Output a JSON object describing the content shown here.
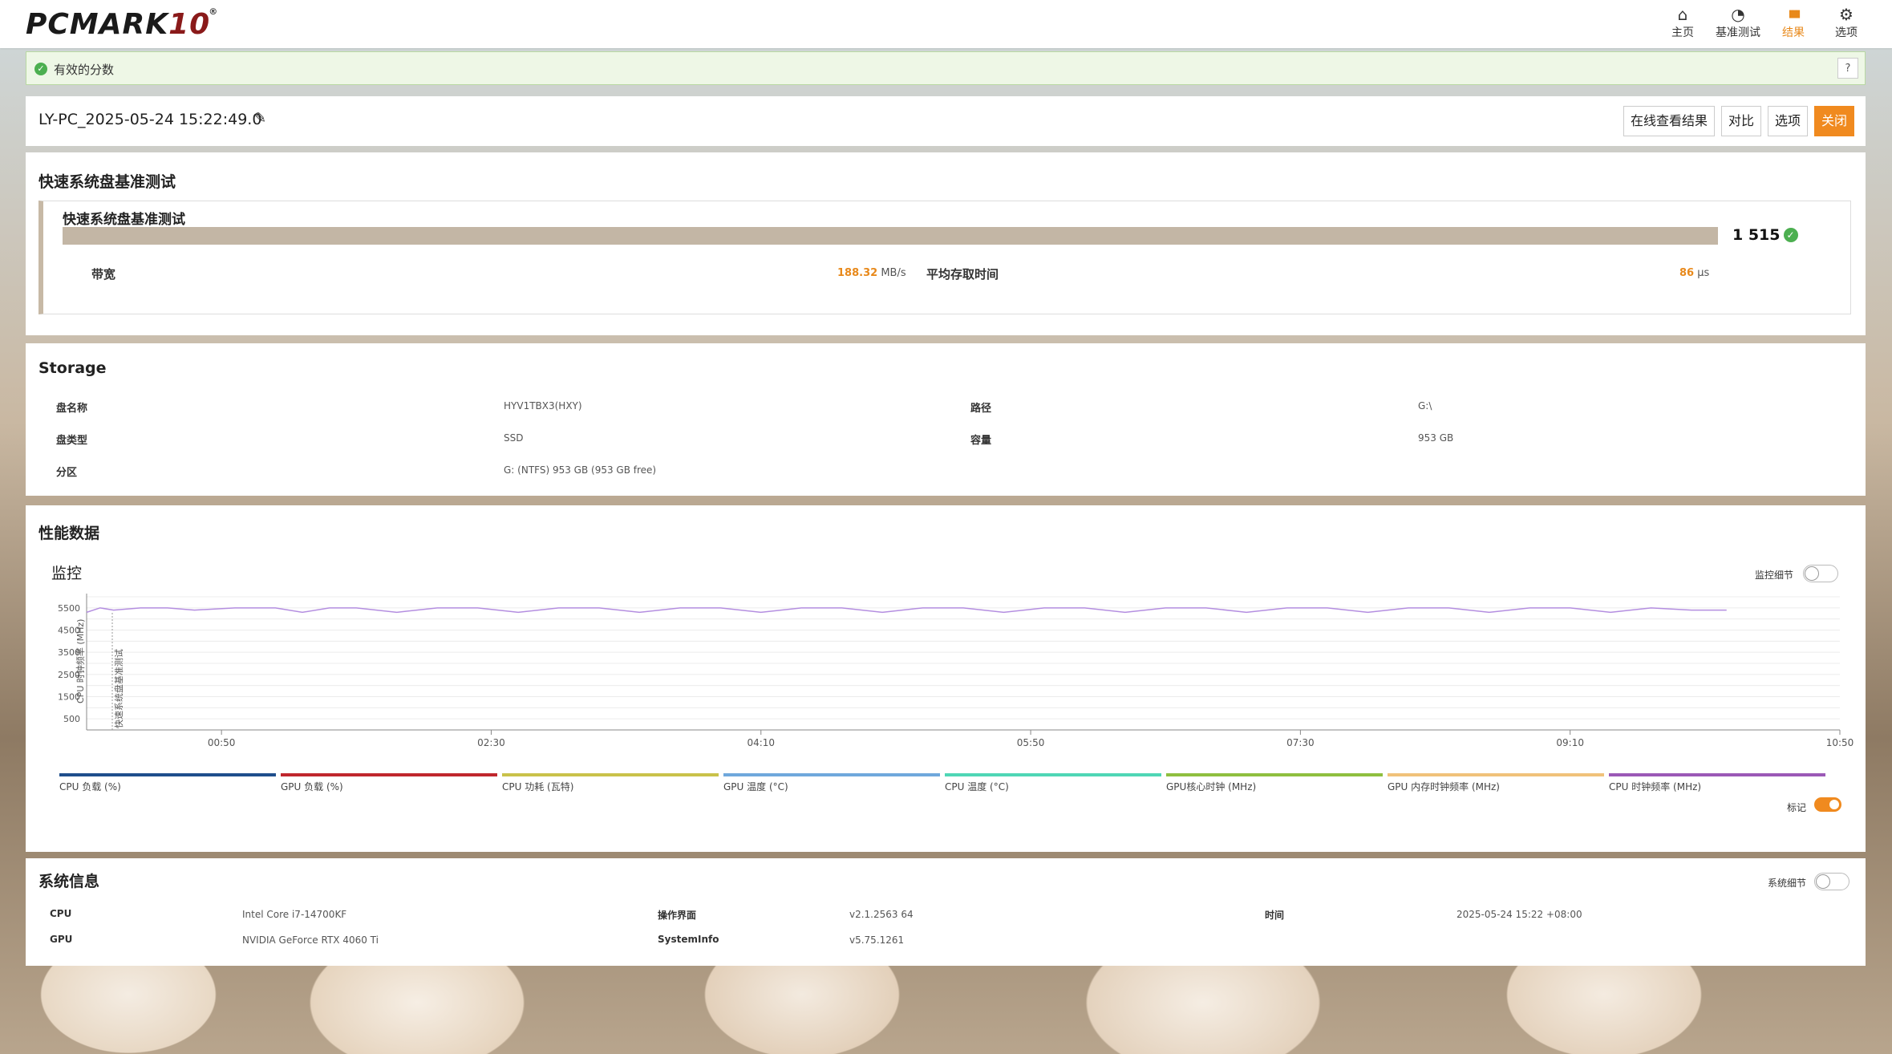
{
  "app": {
    "logo_main": "PCMARK",
    "logo_num": "10",
    "logo_reg": "®"
  },
  "nav": [
    {
      "icon": "home-icon",
      "glyph": "⌂",
      "label": "主页"
    },
    {
      "icon": "gauge-icon",
      "glyph": "◔",
      "label": "基准测试"
    },
    {
      "icon": "bar-chart-icon",
      "glyph": "▮▮▮",
      "label": "结果"
    },
    {
      "icon": "gear-icon",
      "glyph": "⚙",
      "label": "选项"
    }
  ],
  "notice": {
    "text": "有效的分数",
    "help": "?"
  },
  "result": {
    "name": "LY-PC_2025-05-24 15:22:49.0",
    "buttons": {
      "online": "在线查看结果",
      "compare": "对比",
      "options": "选项",
      "close": "关闭"
    }
  },
  "benchmark": {
    "section_title": "快速系统盘基准测试",
    "card_title": "快速系统盘基准测试",
    "score": "1 515",
    "bandwidth_label": "带宽",
    "bandwidth_value": "188.32",
    "bandwidth_unit": "MB/s",
    "access_label": "平均存取时间",
    "access_value": "86",
    "access_unit": "μs"
  },
  "storage": {
    "title": "Storage",
    "rows": [
      {
        "label": "盘名称",
        "value": "HYV1TBX3(HXY)",
        "label2": "路径",
        "value2": "G:\\"
      },
      {
        "label": "盘类型",
        "value": "SSD",
        "label2": "容量",
        "value2": "953 GB"
      },
      {
        "label": "分区",
        "value": "G: (NTFS) 953 GB (953 GB free)"
      }
    ]
  },
  "perf": {
    "section_title": "性能数据",
    "monitor_title": "监控",
    "monitor_toggle_label": "监控细节",
    "marker_toggle_label": "标记",
    "legend": [
      {
        "label": "CPU 负载 (%)",
        "color": "#1f4e8c"
      },
      {
        "label": "GPU 负载 (%)",
        "color": "#c0272d"
      },
      {
        "label": "CPU 功耗 (瓦特)",
        "color": "#c9c24a"
      },
      {
        "label": "GPU 温度 (°C)",
        "color": "#6fa8dc"
      },
      {
        "label": "CPU 温度 (°C)",
        "color": "#4fd6b5"
      },
      {
        "label": "GPU核心时钟 (MHz)",
        "color": "#8fbf3f"
      },
      {
        "label": "GPU 内存时钟频率 (MHz)",
        "color": "#f0c27a"
      },
      {
        "label": "CPU 时钟频率 (MHz)",
        "color": "#9b59b6"
      }
    ]
  },
  "chart_data": {
    "type": "line",
    "ylabel": "CPU 时钟频率 (MHz)",
    "marker_label": "快速系统盘基准测试",
    "yticks": [
      500,
      1500,
      2500,
      3500,
      4500,
      5500
    ],
    "ylim": [
      0,
      6000
    ],
    "xticks": [
      "00:50",
      "02:30",
      "04:10",
      "05:50",
      "07:30",
      "09:10",
      "10:50"
    ],
    "xlim_seconds": [
      0,
      650
    ],
    "series": [
      {
        "name": "CPU 时钟频率 (MHz)",
        "color": "#b48ee0",
        "x": [
          0,
          5,
          10,
          20,
          30,
          40,
          55,
          70,
          80,
          90,
          100,
          115,
          130,
          145,
          160,
          175,
          190,
          205,
          220,
          235,
          250,
          265,
          280,
          295,
          310,
          325,
          340,
          355,
          370,
          385,
          400,
          415,
          430,
          445,
          460,
          475,
          490,
          505,
          520,
          535,
          550,
          565,
          580,
          595,
          608
        ],
        "values": [
          5300,
          5500,
          5400,
          5500,
          5500,
          5400,
          5500,
          5500,
          5300,
          5500,
          5500,
          5300,
          5500,
          5500,
          5300,
          5500,
          5500,
          5300,
          5500,
          5500,
          5300,
          5500,
          5500,
          5300,
          5500,
          5500,
          5300,
          5500,
          5500,
          5300,
          5500,
          5500,
          5300,
          5500,
          5500,
          5300,
          5500,
          5500,
          5300,
          5500,
          5500,
          5300,
          5500,
          5400,
          5400
        ]
      }
    ]
  },
  "sysinfo": {
    "title": "系统信息",
    "toggle_label": "系统细节",
    "rows": [
      {
        "l1": "CPU",
        "v1": "Intel Core i7-14700KF",
        "l2": "操作界面",
        "v2": "v2.1.2563 64",
        "l3": "时间",
        "v3": "2025-05-24 15:22 +08:00"
      },
      {
        "l1": "GPU",
        "v1": "NVIDIA GeForce RTX 4060 Ti",
        "l2": "SystemInfo",
        "v2": "v5.75.1261"
      }
    ]
  }
}
